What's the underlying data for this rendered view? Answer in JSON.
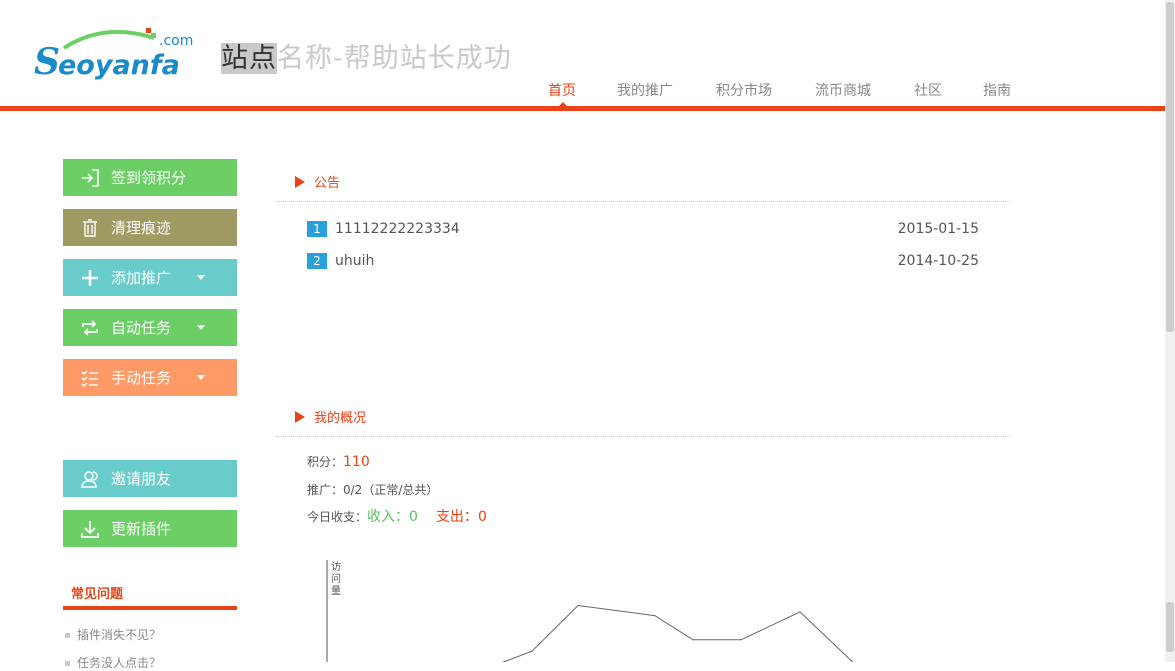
{
  "header": {
    "logo_text": "Seoyanfa",
    "logo_suffix": ".com",
    "site_name_highlight": "站点",
    "site_name_rest": "名称-帮助站长成功"
  },
  "nav": {
    "items": [
      "首页",
      "我的推广",
      "积分市场",
      "流币商城",
      "社区",
      "指南"
    ],
    "active": "首页"
  },
  "sidebar": {
    "buttons": [
      {
        "label": "签到领积分",
        "icon": "sign-in-icon",
        "color": "#6ccf66"
      },
      {
        "label": "清理痕迹",
        "icon": "trash-icon",
        "color": "#a09a63"
      },
      {
        "label": "添加推广",
        "icon": "plus-icon",
        "color": "#68cccb"
      },
      {
        "label": "自动任务",
        "icon": "repeat-icon",
        "color": "#6ccf66"
      },
      {
        "label": "手动任务",
        "icon": "checklist-icon",
        "color": "#ff9966"
      },
      {
        "label": "邀请朋友",
        "icon": "users-icon",
        "color": "#68cccb"
      },
      {
        "label": "更新插件",
        "icon": "download-icon",
        "color": "#6ccf66"
      }
    ],
    "faq_title": "常见问题",
    "faq_items": [
      "插件消失不见？",
      "任务没人点击？"
    ]
  },
  "announcements": {
    "title": "公告",
    "items": [
      {
        "num": "1",
        "text": "11112222223334",
        "date": "2015-01-15"
      },
      {
        "num": "2",
        "text": "uhuih",
        "date": "2014-10-25"
      }
    ]
  },
  "overview": {
    "title": "我的概况",
    "points_label": "积分：",
    "points_value": "110",
    "promo_text": "推广：0/2（正常/总共）",
    "today_label": "今日收支：",
    "income_label": "收入：",
    "income_value": "0",
    "expense_label": "支出：",
    "expense_value": "0"
  },
  "chart_data": {
    "type": "line",
    "ylabel": "访问量",
    "values": [
      0,
      14,
      50,
      42,
      23,
      23,
      45,
      0
    ]
  },
  "colors": {
    "accent": "#e84417",
    "nav_text": "#888888",
    "notice_badge": "#29a1d8",
    "income_green": "#5bc25b"
  }
}
